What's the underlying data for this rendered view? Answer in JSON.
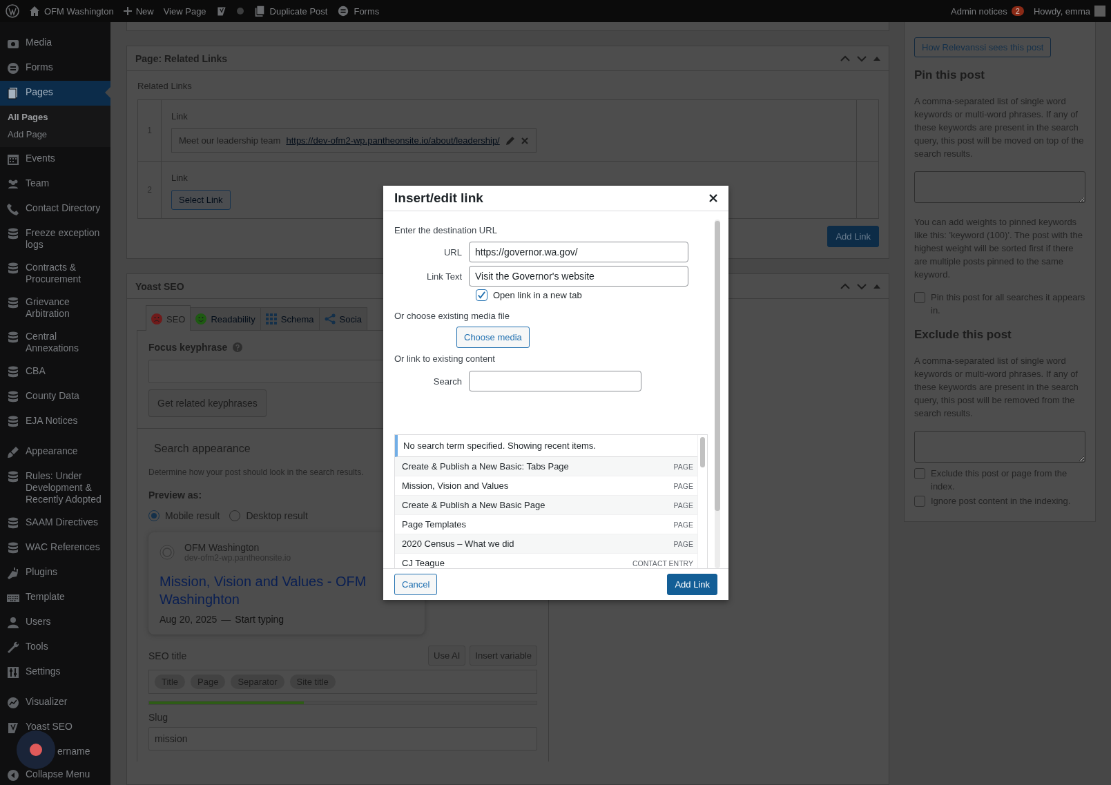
{
  "admin_bar": {
    "site": "OFM Washington",
    "items": [
      {
        "kind": "new",
        "label": "New"
      },
      {
        "kind": "link",
        "label": "View Page"
      },
      {
        "kind": "yoast"
      },
      {
        "kind": "status"
      },
      {
        "kind": "duplicate",
        "label": "Duplicate Post"
      },
      {
        "kind": "forms",
        "label": "Forms"
      }
    ],
    "notices": {
      "label": "Admin notices",
      "count": "2"
    },
    "greeting": "Howdy, emma"
  },
  "sidebar": {
    "groups": [
      {
        "items": [
          {
            "kind": "media",
            "label": "Media",
            "selected": false
          },
          {
            "kind": "forms",
            "label": "Forms",
            "selected": false
          },
          {
            "kind": "pages",
            "label": "Pages",
            "selected": true,
            "children": [
              {
                "label": "All Pages",
                "selected": true
              },
              {
                "label": "Add Page",
                "selected": false
              }
            ]
          },
          {
            "kind": "events",
            "label": "Events",
            "selected": false
          },
          {
            "kind": "team",
            "label": "Team",
            "selected": false
          },
          {
            "kind": "phone",
            "label": "Contact Directory",
            "selected": false
          },
          {
            "kind": "database",
            "label": "Freeze exception logs",
            "selected": false
          },
          {
            "kind": "database",
            "label": "Contracts & Procurement",
            "selected": false
          },
          {
            "kind": "database",
            "label": "Grievance Arbitration",
            "selected": false
          },
          {
            "kind": "database",
            "label": "Central Annexations",
            "selected": false
          },
          {
            "kind": "database",
            "label": "CBA",
            "selected": false
          },
          {
            "kind": "database",
            "label": "County Data",
            "selected": false
          },
          {
            "kind": "database",
            "label": "EJA Notices",
            "selected": false
          }
        ]
      },
      {
        "items": [
          {
            "kind": "appearance",
            "label": "Appearance",
            "selected": false
          },
          {
            "kind": "database",
            "label": "Rules: Under Development & Recently Adopted",
            "selected": false
          },
          {
            "kind": "database",
            "label": "SAAM Directives",
            "selected": false
          },
          {
            "kind": "database",
            "label": "WAC References",
            "selected": false
          },
          {
            "kind": "plugins",
            "label": "Plugins",
            "selected": false
          },
          {
            "kind": "template",
            "label": "Template",
            "selected": false
          },
          {
            "kind": "users",
            "label": "Users",
            "selected": false
          },
          {
            "kind": "tools",
            "label": "Tools",
            "selected": false
          },
          {
            "kind": "settings",
            "label": "Settings",
            "selected": false
          }
        ]
      },
      {
        "items": [
          {
            "kind": "visualizer",
            "label": "Visualizer",
            "selected": false
          },
          {
            "kind": "yoast",
            "label": "Yoast SEO",
            "selected": false
          },
          {
            "label": "ername",
            "selected": false
          },
          {
            "kind": "collapse",
            "label": "Collapse Menu",
            "selected": false
          }
        ]
      }
    ]
  },
  "related_links": {
    "title": "Page: Related Links",
    "field_label": "Related Links",
    "rows": [
      {
        "number": "1",
        "label": "Link",
        "text": "Meet our leadership team",
        "url": "https://dev-ofm2-wp.pantheonsite.io/about/leadership/"
      },
      {
        "number": "2",
        "label": "Link",
        "button": "Select Link"
      }
    ],
    "add_button": "Add Link"
  },
  "yoast": {
    "title": "Yoast SEO",
    "tabs": [
      {
        "kind": "seo",
        "label": "SEO",
        "selected": true
      },
      {
        "kind": "readability",
        "label": "Readability",
        "selected": false
      },
      {
        "kind": "schema",
        "label": "Schema",
        "selected": false
      },
      {
        "kind": "social",
        "label": "Socia",
        "selected": false
      }
    ],
    "focus_label": "Focus keyphrase",
    "related_button": "Get related keyphrases",
    "search_heading": "Search appearance",
    "search_desc": "Determine how your post should look in the search results.",
    "preview_label": "Preview as:",
    "preview_options": [
      {
        "label": "Mobile result",
        "selected": true
      },
      {
        "label": "Desktop result",
        "selected": false
      }
    ],
    "preview": {
      "site": "OFM Washington",
      "url": "dev-ofm2-wp.pantheonsite.io",
      "title": "Mission, Vision and Values - OFM Washinghton",
      "date": "Aug 20, 2025",
      "separator": "—",
      "description": "Start typing"
    },
    "seo_title_label": "SEO title",
    "seo_title_buttons": [
      "Use AI",
      "Insert variable"
    ],
    "seo_title_chips": [
      "Title",
      "Page",
      "Separator",
      "Site title"
    ],
    "seo_title_score": {
      "level": 0.4
    },
    "slug_label": "Slug",
    "slug": "mission"
  },
  "relevanssi": {
    "button": "How Relevanssi sees this post",
    "pin_heading": "Pin this post",
    "pin_desc": "A comma-separated list of single word keywords or multi-word phrases. If any of these keywords are present in the search query, this post will be moved on top of the search results.",
    "weights_desc": "You can add weights to pinned keywords like this: 'keyword (100)'. The post with the highest weight will be sorted first if there are multiple posts pinned to the same keyword.",
    "pin_all": {
      "label": "Pin this post for all searches it appears in.",
      "checked": false
    },
    "exclude_heading": "Exclude this post",
    "exclude_desc": "A comma-separated list of single word keywords or multi-word phrases. If any of these keywords are present in the search query, this post will be removed from the search results.",
    "options": [
      {
        "label": "Exclude this post or page from the index.",
        "checked": false
      },
      {
        "label": "Ignore post content in the indexing.",
        "checked": false
      }
    ]
  },
  "dialog": {
    "title": "Insert/edit link",
    "url_heading": "Enter the destination URL",
    "url_label": "URL",
    "url": "https://governor.wa.gov/",
    "text_label": "Link Text",
    "text": "Visit the Governor's website",
    "new_tab": {
      "label": "Open link in a new tab",
      "checked": true
    },
    "media_heading": "Or choose existing media file",
    "media_button": "Choose media",
    "content_heading": "Or link to existing content",
    "search_label": "Search",
    "results_notice": "No search term specified. Showing recent items.",
    "results": [
      {
        "title": "Create & Publish a New Basic: Tabs Page",
        "type": "PAGE"
      },
      {
        "title": "Mission, Vision and Values",
        "type": "PAGE"
      },
      {
        "title": "Create & Publish a New Basic Page",
        "type": "PAGE"
      },
      {
        "title": "Page Templates",
        "type": "PAGE"
      },
      {
        "title": "2020 Census – What we did",
        "type": "PAGE"
      },
      {
        "title": "CJ Teague",
        "type": "CONTACT ENTRY"
      }
    ],
    "cancel": "Cancel",
    "submit": "Add Link"
  }
}
